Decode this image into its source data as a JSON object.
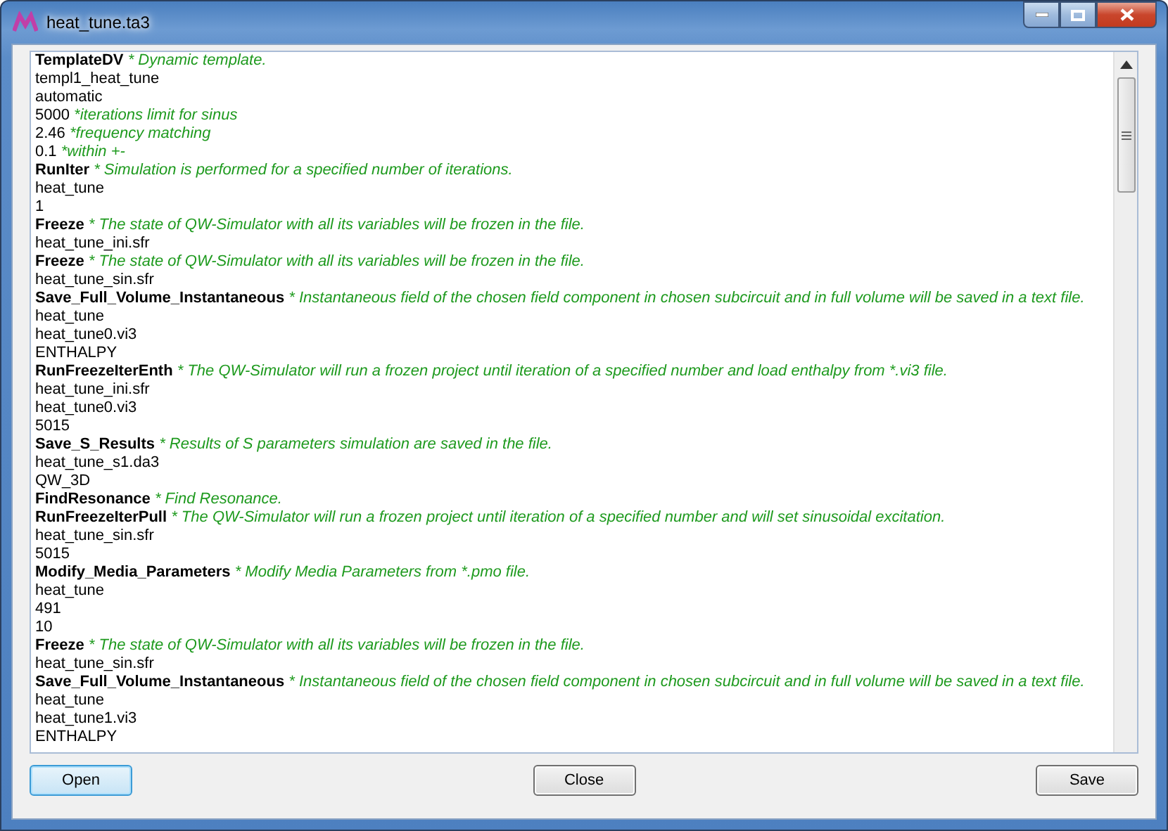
{
  "window": {
    "title": "heat_tune.ta3"
  },
  "lines": [
    {
      "kind": "command",
      "text": "TemplateDV",
      "comment": "* Dynamic template."
    },
    {
      "kind": "value",
      "text": "templ1_heat_tune"
    },
    {
      "kind": "value",
      "text": "automatic"
    },
    {
      "kind": "value",
      "text": "5000",
      "comment": "*iterations limit for sinus"
    },
    {
      "kind": "value",
      "text": "2.46",
      "comment": "*frequency matching"
    },
    {
      "kind": "value",
      "text": "0.1",
      "comment": "*within +-"
    },
    {
      "kind": "command",
      "text": "RunIter",
      "comment": "* Simulation is performed for a specified number of iterations."
    },
    {
      "kind": "value",
      "text": "heat_tune"
    },
    {
      "kind": "value",
      "text": "1"
    },
    {
      "kind": "command",
      "text": "Freeze",
      "comment": "* The state of QW-Simulator with all its variables will be frozen in the file."
    },
    {
      "kind": "value",
      "text": "heat_tune_ini.sfr"
    },
    {
      "kind": "command",
      "text": "Freeze",
      "comment": "* The state of QW-Simulator with all its variables will be frozen in the file."
    },
    {
      "kind": "value",
      "text": "heat_tune_sin.sfr"
    },
    {
      "kind": "command",
      "text": "Save_Full_Volume_Instantaneous",
      "comment": "* Instantaneous field of the chosen field component in chosen subcircuit and in full volume will be saved in a text file."
    },
    {
      "kind": "value",
      "text": "heat_tune"
    },
    {
      "kind": "value",
      "text": "heat_tune0.vi3"
    },
    {
      "kind": "value",
      "text": "ENTHALPY"
    },
    {
      "kind": "command",
      "text": "RunFreezeIterEnth",
      "comment": "* The QW-Simulator will run a frozen project until iteration of a specified number and load enthalpy from *.vi3 file."
    },
    {
      "kind": "value",
      "text": "heat_tune_ini.sfr"
    },
    {
      "kind": "value",
      "text": "heat_tune0.vi3"
    },
    {
      "kind": "value",
      "text": "5015"
    },
    {
      "kind": "command",
      "text": "Save_S_Results",
      "comment": "* Results of S parameters simulation are saved in the file."
    },
    {
      "kind": "value",
      "text": "heat_tune_s1.da3"
    },
    {
      "kind": "value",
      "text": "QW_3D"
    },
    {
      "kind": "command",
      "text": "FindResonance",
      "comment": "* Find Resonance."
    },
    {
      "kind": "command",
      "text": "RunFreezeIterPull",
      "comment": "* The QW-Simulator will run a frozen project until iteration of a specified number and will set sinusoidal excitation."
    },
    {
      "kind": "value",
      "text": "heat_tune_sin.sfr"
    },
    {
      "kind": "value",
      "text": "5015"
    },
    {
      "kind": "command",
      "text": "Modify_Media_Parameters",
      "comment": "* Modify Media Parameters from *.pmo file."
    },
    {
      "kind": "value",
      "text": "heat_tune"
    },
    {
      "kind": "value",
      "text": "491"
    },
    {
      "kind": "value",
      "text": "10"
    },
    {
      "kind": "command",
      "text": "Freeze",
      "comment": "* The state of QW-Simulator with all its variables will be frozen in the file."
    },
    {
      "kind": "value",
      "text": "heat_tune_sin.sfr"
    },
    {
      "kind": "command",
      "text": "Save_Full_Volume_Instantaneous",
      "comment": "* Instantaneous field of the chosen field component in chosen subcircuit and in full volume will be saved in a text file."
    },
    {
      "kind": "value",
      "text": "heat_tune"
    },
    {
      "kind": "value",
      "text": "heat_tune1.vi3"
    },
    {
      "kind": "value",
      "text": "ENTHALPY"
    }
  ],
  "buttons": [
    {
      "label": "Open",
      "focused": true
    },
    {
      "label": "Close",
      "focused": false
    },
    {
      "label": "Save",
      "focused": false
    }
  ]
}
